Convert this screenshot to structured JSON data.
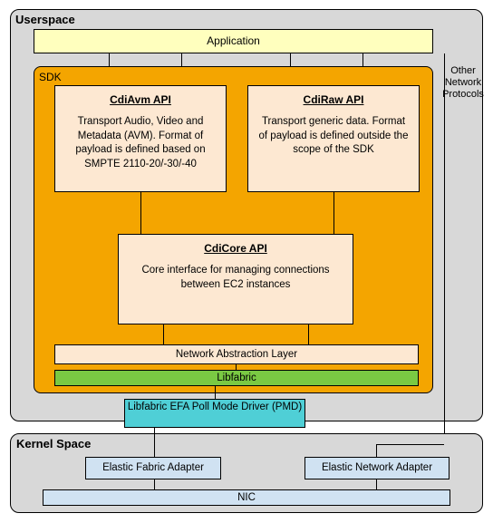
{
  "userspace": {
    "title": "Userspace"
  },
  "application": {
    "label": "Application"
  },
  "other_network": {
    "text": "Other Network Protocols"
  },
  "sdk": {
    "title": "SDK"
  },
  "cdiavm": {
    "title": "CdiAvm API",
    "desc": "Transport Audio, Video and Metadata (AVM). Format of payload is defined based on SMPTE 2110-20/-30/-40"
  },
  "cdiraw": {
    "title": "CdiRaw API",
    "desc": "Transport generic data. Format of payload is defined outside the scope of the SDK"
  },
  "cdicore": {
    "title": "CdiCore API",
    "desc": "Core interface for managing connections between EC2 instances"
  },
  "nal": {
    "label": "Network Abstraction Layer"
  },
  "libfabric": {
    "label": "Libfabric"
  },
  "pmd": {
    "label": "Libfabric EFA Poll Mode Driver (PMD)"
  },
  "kernel": {
    "title": "Kernel Space"
  },
  "efa": {
    "label": "Elastic Fabric Adapter"
  },
  "ena": {
    "label": "Elastic Network Adapter"
  },
  "nic": {
    "label": "NIC"
  }
}
